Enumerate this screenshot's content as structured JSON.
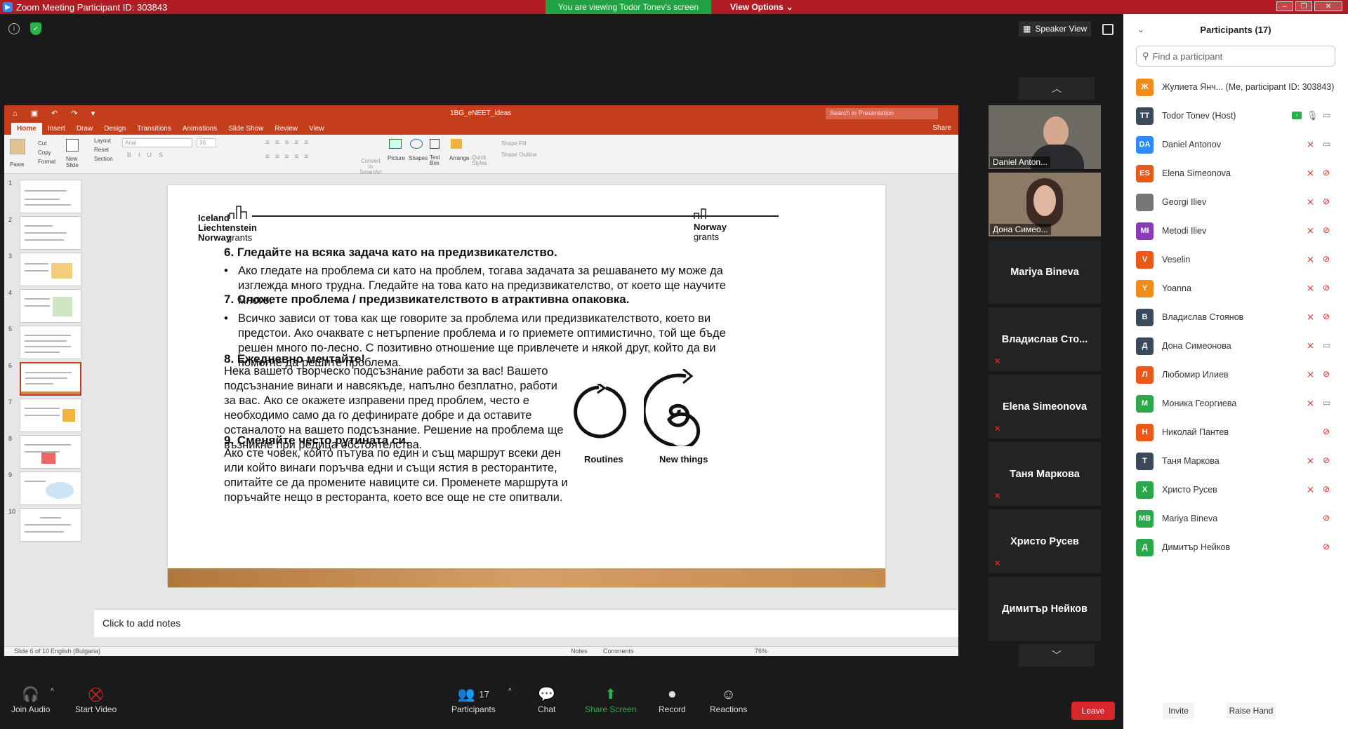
{
  "window": {
    "title": "Zoom Meeting Participant ID: 303843",
    "viewing_banner": "You are viewing Todor Tonev's screen",
    "view_options": "View Options"
  },
  "stage": {
    "speaker_view": "Speaker View"
  },
  "ppt": {
    "filename": "1BG_eNEET_ideas",
    "search_placeholder": "Search in Presentation",
    "tabs": [
      "Home",
      "Insert",
      "Draw",
      "Design",
      "Transitions",
      "Animations",
      "Slide Show",
      "Review",
      "View"
    ],
    "share": "Share",
    "ribbon": {
      "paste": "Paste",
      "cut": "Cut",
      "copy": "Copy",
      "format": "Format",
      "new_slide": "New Slide",
      "layout": "Layout",
      "reset": "Reset",
      "section": "Section",
      "font": "Arial",
      "font_size": "36",
      "convert": "Convert to SmartArt",
      "picture": "Picture",
      "shapes": "Shapes",
      "text_box": "Text Box",
      "arrange": "Arrange",
      "quick_styles": "Quick Styles",
      "shape_fill": "Shape Fill",
      "shape_outline": "Shape Outline"
    },
    "thumb_numbers": [
      "1",
      "2",
      "3",
      "4",
      "5",
      "6",
      "7",
      "8",
      "9",
      "10"
    ],
    "notes_placeholder": "Click to add notes",
    "status": {
      "slide": "Slide 6 of 10",
      "language": "English (Bulgaria)",
      "notes": "Notes",
      "comments": "Comments",
      "zoom": "76%"
    },
    "slide": {
      "logo_left": [
        "Iceland",
        "Liechtenstein",
        "Norway"
      ],
      "logo_left_grants": "grants",
      "logo_right": "Norway",
      "logo_right_grants": "grants",
      "h6": "6. Гледайте на всяка задача като на предизвикателство.",
      "b6": "Ако гледате на проблема си като на проблем, тогава задачата за решаването му може да изглежда много трудна. Гледайте на това като на предизвикателство, от което ще научите много.",
      "h7": "7. Сложете проблема / предизвикателството в атрактивна опаковка.",
      "b7": "Всичко зависи от това как ще говорите за проблема или предизвикателството, което ви предстои. Ако очаквате с нетърпение проблема и го приемете оптимистично, той ще бъде решен много по-лесно. С позитивно отношение ще привлечете и някой друг, който да ви помогне да решите проблема.",
      "h8": "8. Ежедневно мечтайте!",
      "p8": "Нека вашето творческо подсъзнание работи за вас! Вашето подсъзнание винаги и навсякъде, напълно безплатно, работи за вас. Ако се окажете изправени пред проблем, често е необходимо само да го дефинирате добре и да оставите останалото на вашето подсъзнание. Решение на проблема ще възникне при редица обстоятелства.",
      "h9": "9. Сменяйте често рутината си.",
      "p9": "Ако сте човек, който пътува по един и същ маршрут всеки ден или който винаги поръчва едни и същи ястия в ресторантите, опитайте се да промените навиците си. Променете маршрута и поръчайте нещо в ресторанта, което все още не сте опитвали.",
      "cap_routines": "Routines",
      "cap_new": "New things"
    }
  },
  "tiles": [
    {
      "label": "Daniel Anton...",
      "type": "video"
    },
    {
      "label": "Дона Симео...",
      "type": "video"
    },
    {
      "label": "Mariya Bineva",
      "type": "name",
      "muted": false
    },
    {
      "label": "Владислав  Сто...",
      "type": "name",
      "muted": true
    },
    {
      "label": "Elena Simeonova",
      "type": "name",
      "muted": true
    },
    {
      "label": "Таня Маркова",
      "type": "name",
      "muted": true
    },
    {
      "label": "Христо Русев",
      "type": "name",
      "muted": true
    },
    {
      "label": "Димитър Нейков",
      "type": "name",
      "muted": false
    }
  ],
  "toolbar": {
    "join_audio": "Join Audio",
    "start_video": "Start Video",
    "participants": "Participants",
    "participants_count": "17",
    "chat": "Chat",
    "share_screen": "Share Screen",
    "record": "Record",
    "reactions": "Reactions",
    "leave": "Leave"
  },
  "panel": {
    "title": "Participants (17)",
    "search_placeholder": "Find a participant",
    "invite": "Invite",
    "raise_hand": "Raise Hand",
    "participants": [
      {
        "initials": "Ж",
        "name": "Жулиета Янч... (Me, participant ID: 303843)",
        "color": "#f08c1a",
        "mic": "",
        "cam": ""
      },
      {
        "initials": "TT",
        "name": "Todor Tonev (Host)",
        "color": "#3a4a5c",
        "mic": "on",
        "cam": "on",
        "share": true
      },
      {
        "initials": "DA",
        "name": "Daniel Antonov",
        "color": "#2d8cff",
        "mic": "off",
        "cam": "on"
      },
      {
        "initials": "ES",
        "name": "Elena Simeonova",
        "color": "#e8591a",
        "mic": "off",
        "cam": "off"
      },
      {
        "initials": "",
        "name": "Georgi Iliev",
        "color": "#777777",
        "mic": "off",
        "cam": "off"
      },
      {
        "initials": "MI",
        "name": "Metodi Iliev",
        "color": "#8a3db6",
        "mic": "off",
        "cam": "off"
      },
      {
        "initials": "V",
        "name": "Veselin",
        "color": "#e8591a",
        "mic": "off",
        "cam": "off"
      },
      {
        "initials": "Y",
        "name": "Yoanna",
        "color": "#f08c1a",
        "mic": "off",
        "cam": "off"
      },
      {
        "initials": "В",
        "name": "Владислав Стоянов",
        "color": "#3a4a5c",
        "mic": "off",
        "cam": "off"
      },
      {
        "initials": "Д",
        "name": "Дона Симеонова",
        "color": "#3a4a5c",
        "mic": "off",
        "cam": "on"
      },
      {
        "initials": "Л",
        "name": "Любомир Илиев",
        "color": "#e8591a",
        "mic": "off",
        "cam": "off"
      },
      {
        "initials": "М",
        "name": "Моника Георгиева",
        "color": "#2aa84a",
        "mic": "off",
        "cam": "on"
      },
      {
        "initials": "Н",
        "name": "Николай Пантев",
        "color": "#e8591a",
        "mic": "",
        "cam": "off"
      },
      {
        "initials": "Т",
        "name": "Таня Маркова",
        "color": "#3a4a5c",
        "mic": "off",
        "cam": "off"
      },
      {
        "initials": "Х",
        "name": "Христо Русев",
        "color": "#2aa84a",
        "mic": "off",
        "cam": "off"
      },
      {
        "initials": "MB",
        "name": "Mariya Bineva",
        "color": "#2aa84a",
        "mic": "",
        "cam": "off"
      },
      {
        "initials": "Д",
        "name": "Димитър Нейков",
        "color": "#2aa84a",
        "mic": "",
        "cam": "off"
      }
    ]
  }
}
